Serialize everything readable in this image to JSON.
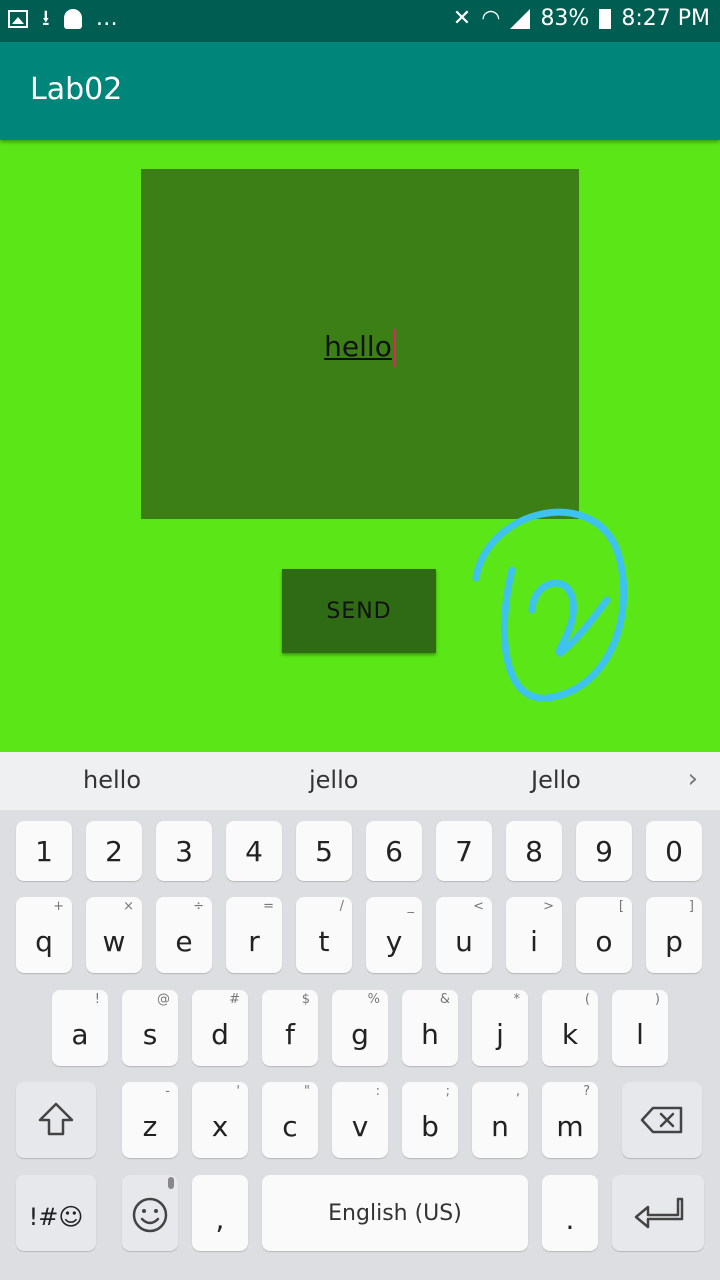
{
  "status_bar": {
    "battery": "83%",
    "time": "8:27 PM",
    "left_icons": [
      "gallery-icon",
      "download-icon",
      "snapchat-icon",
      "more-dots-icon"
    ],
    "right_icons": [
      "vibrate-mute-icon",
      "wifi-icon",
      "signal-icon",
      "battery-charging-icon"
    ]
  },
  "app_bar": {
    "title": "Lab02"
  },
  "main": {
    "input_text": "hello",
    "send_label": "SEND",
    "annotation_digit": "2"
  },
  "suggestions": {
    "items": [
      "hello",
      "jello",
      "Jello"
    ],
    "more_icon": "chevron-right-icon"
  },
  "keyboard": {
    "numbers": [
      "1",
      "2",
      "3",
      "4",
      "5",
      "6",
      "7",
      "8",
      "9",
      "0"
    ],
    "row1": [
      {
        "key": "q",
        "sub": "+"
      },
      {
        "key": "w",
        "sub": "×"
      },
      {
        "key": "e",
        "sub": "÷"
      },
      {
        "key": "r",
        "sub": "="
      },
      {
        "key": "t",
        "sub": "/"
      },
      {
        "key": "y",
        "sub": "_"
      },
      {
        "key": "u",
        "sub": "<"
      },
      {
        "key": "i",
        "sub": ">"
      },
      {
        "key": "o",
        "sub": "["
      },
      {
        "key": "p",
        "sub": "]"
      }
    ],
    "row2": [
      {
        "key": "a",
        "sub": "!"
      },
      {
        "key": "s",
        "sub": "@"
      },
      {
        "key": "d",
        "sub": "#"
      },
      {
        "key": "f",
        "sub": "$"
      },
      {
        "key": "g",
        "sub": "%"
      },
      {
        "key": "h",
        "sub": "&"
      },
      {
        "key": "j",
        "sub": "*"
      },
      {
        "key": "k",
        "sub": "("
      },
      {
        "key": "l",
        "sub": ")"
      }
    ],
    "row3": [
      {
        "key": "z",
        "sub": "-"
      },
      {
        "key": "x",
        "sub": "'"
      },
      {
        "key": "c",
        "sub": "\""
      },
      {
        "key": "v",
        "sub": ":"
      },
      {
        "key": "b",
        "sub": ";"
      },
      {
        "key": "n",
        "sub": ","
      },
      {
        "key": "m",
        "sub": "?"
      }
    ],
    "symbols_label": "!#☺",
    "comma": ",",
    "space_label": "English (US)",
    "period": ".",
    "icons": {
      "shift": "shift-icon",
      "backspace": "backspace-icon",
      "emoji": "emoji-icon",
      "enter": "enter-icon"
    }
  }
}
